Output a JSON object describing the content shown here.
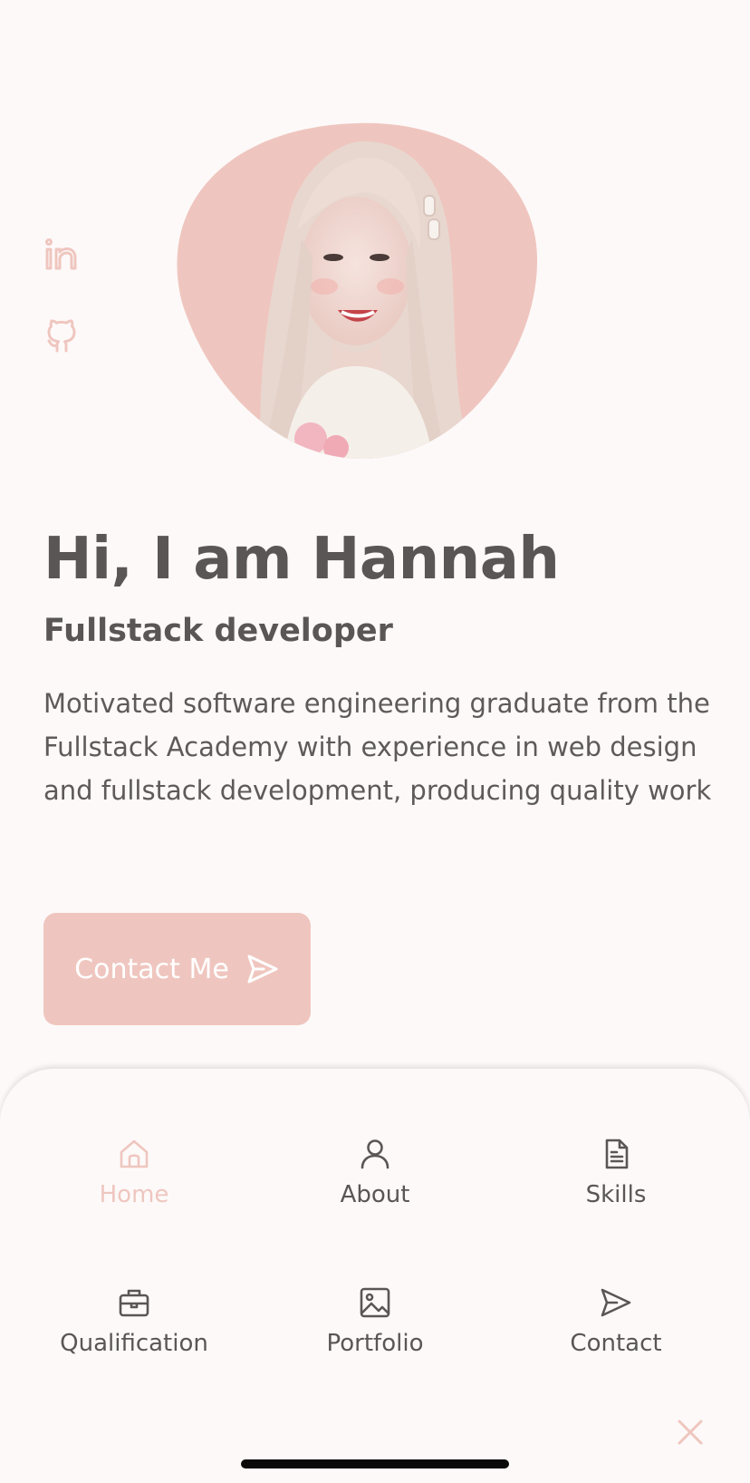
{
  "colors": {
    "accent": "#efc6bf",
    "text": "#5b5656",
    "background": "#fdf9f9"
  },
  "social": [
    {
      "name": "LinkedIn",
      "icon": "linkedin-icon"
    },
    {
      "name": "GitHub",
      "icon": "github-icon"
    }
  ],
  "profile": {
    "image": "portrait photo of woman with long light blonde hair in pink blob frame"
  },
  "hero": {
    "title": "Hi, I am Hannah",
    "subtitle": "Fullstack developer",
    "description": "Motivated software engineering graduate from the Fullstack Academy with experience in web design and fullstack development, producing quality work",
    "cta_label": "Contact Me",
    "cta_icon": "send-icon"
  },
  "nav": {
    "items": [
      {
        "label": "Home",
        "icon": "home-icon",
        "active": true
      },
      {
        "label": "About",
        "icon": "user-icon",
        "active": false
      },
      {
        "label": "Skills",
        "icon": "file-icon",
        "active": false
      },
      {
        "label": "Qualification",
        "icon": "briefcase-icon",
        "active": false
      },
      {
        "label": "Portfolio",
        "icon": "image-icon",
        "active": false
      },
      {
        "label": "Contact",
        "icon": "send-icon",
        "active": false
      }
    ],
    "close_icon": "close-icon"
  }
}
